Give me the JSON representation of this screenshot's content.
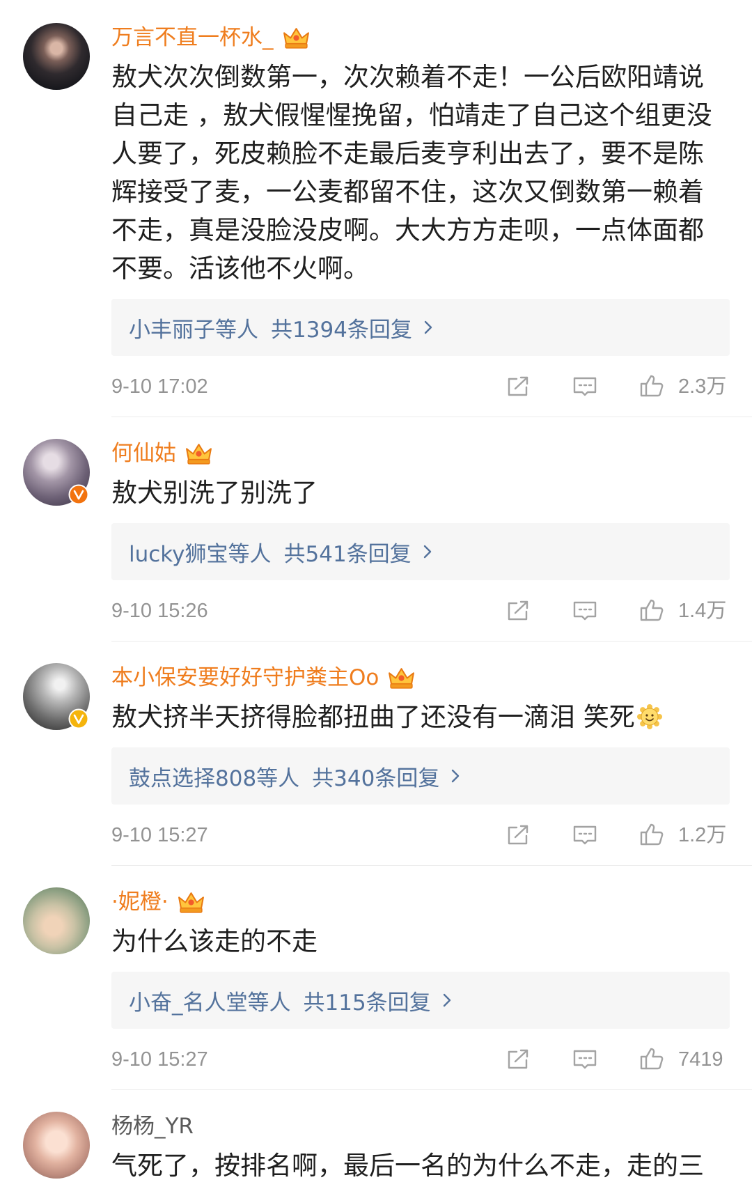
{
  "colors": {
    "vip_name": "#ef7d1e",
    "normal_name": "#5a5a5a",
    "body_text": "#1f1f1f",
    "meta_text": "#939393",
    "reply_link": "#53729c",
    "reply_bg": "#f6f6f6",
    "divider": "#ececec",
    "icon": "#a3a3a3",
    "verified_orange": "#f2730f",
    "verified_yellow": "#f5b40c"
  },
  "icons": {
    "vip": "vip-crown-icon",
    "verified": "verified-badge-icon",
    "share": "share-icon",
    "comment": "comment-icon",
    "like": "thumb-up-icon",
    "chevron": "chevron-right-icon",
    "emoji": "smile-emoji-icon"
  },
  "comments": [
    {
      "username": "万言不直一杯水_",
      "vip": true,
      "verified_color": null,
      "text_lines": [
        "敖犬次次倒数第一，次次赖着不走！一公后欧阳靖说",
        "自己走 ，敖犬假惺惺挽留，怕靖走了自己这个组更没",
        "人要了，死皮赖脸不走最后麦亨利出去了，要不是陈",
        "辉接受了麦，一公麦都留不住，这次又倒数第一赖着",
        "不走，真是没脸没皮啊。大大方方走呗，一点体面都",
        "不要。活该他不火啊。"
      ],
      "replies": {
        "who": "小丰丽子等人",
        "total": "共1394条回复"
      },
      "time": "9-10 17:02",
      "likes": "2.3万"
    },
    {
      "username": "何仙姑",
      "vip": true,
      "verified_color": "#f2730f",
      "text_lines": [
        "敖犬别洗了别洗了"
      ],
      "replies": {
        "who": "lucky狮宝等人",
        "total": "共541条回复"
      },
      "time": "9-10 15:26",
      "likes": "1.4万"
    },
    {
      "username": "本小保安要好好守护粪主Oo",
      "vip": true,
      "verified_color": "#f5b40c",
      "text_lines": [
        "敖犬挤半天挤得脸都扭曲了还没有一滴泪 笑死"
      ],
      "emoji": "smile-emoji-icon",
      "replies": {
        "who": "鼓点选择808等人",
        "total": "共340条回复"
      },
      "time": "9-10 15:27",
      "likes": "1.2万"
    },
    {
      "username": "·妮橙·",
      "vip": true,
      "verified_color": null,
      "text_lines": [
        "为什么该走的不走"
      ],
      "replies": {
        "who": "小奋_名人堂等人",
        "total": "共115条回复"
      },
      "time": "9-10 15:27",
      "likes": "7419"
    },
    {
      "username": "杨杨_YR",
      "vip": false,
      "verified_color": null,
      "text_lines": [
        "气死了，按排名啊，最后一名的为什么不走，走的三"
      ]
    }
  ]
}
